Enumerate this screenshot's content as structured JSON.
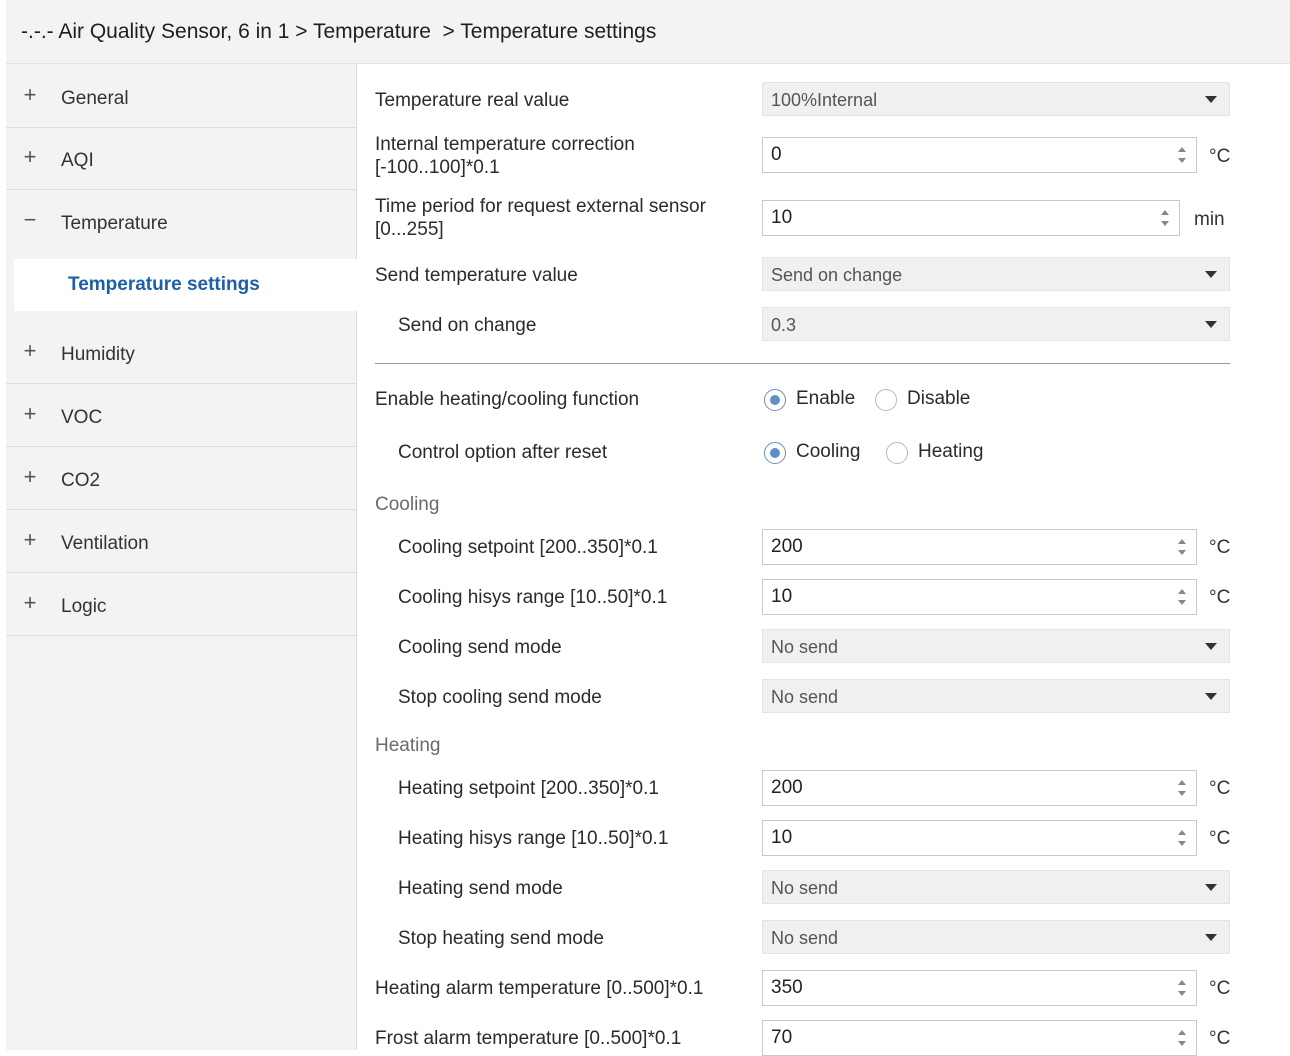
{
  "breadcrumb": "-.-.- Air Quality Sensor, 6 in 1 > Temperature  > Temperature settings",
  "sidebar": {
    "items": [
      {
        "sign": "+",
        "label": "General"
      },
      {
        "sign": "+",
        "label": "AQI"
      },
      {
        "sign": "−",
        "label": "Temperature"
      },
      {
        "sign": "+",
        "label": "Humidity"
      },
      {
        "sign": "+",
        "label": "VOC"
      },
      {
        "sign": "+",
        "label": "CO2"
      },
      {
        "sign": "+",
        "label": "Ventilation"
      },
      {
        "sign": "+",
        "label": "Logic"
      }
    ],
    "active_sub": "Temperature settings"
  },
  "form": {
    "temp_real_value": {
      "label": "Temperature real value",
      "value": "100%Internal"
    },
    "internal_correction": {
      "label": "Internal temperature correction\n[-100..100]*0.1",
      "value": "0",
      "unit": "°C"
    },
    "time_period": {
      "label": "Time period for request external sensor\n[0...255]",
      "value": "10",
      "unit": "min"
    },
    "send_temp_value": {
      "label": "Send temperature value",
      "value": "Send on change"
    },
    "send_on_change": {
      "label": "Send on change",
      "value": "0.3"
    },
    "enable_hc": {
      "label": "Enable heating/cooling function",
      "opt1": "Enable",
      "opt2": "Disable",
      "selected": "Enable"
    },
    "control_option": {
      "label": "Control option after reset",
      "opt1": "Cooling",
      "opt2": "Heating",
      "selected": "Cooling"
    },
    "cooling_section": "Cooling",
    "cooling_setpoint": {
      "label": "Cooling setpoint [200..350]*0.1",
      "value": "200",
      "unit": "°C"
    },
    "cooling_hisys": {
      "label": "Cooling hisys range [10..50]*0.1",
      "value": "10",
      "unit": "°C"
    },
    "cooling_send_mode": {
      "label": "Cooling send mode",
      "value": "No send"
    },
    "stop_cooling_send_mode": {
      "label": "Stop cooling send mode",
      "value": "No send"
    },
    "heating_section": "Heating",
    "heating_setpoint": {
      "label": "Heating setpoint [200..350]*0.1",
      "value": "200",
      "unit": "°C"
    },
    "heating_hisys": {
      "label": "Heating hisys range [10..50]*0.1",
      "value": "10",
      "unit": "°C"
    },
    "heating_send_mode": {
      "label": "Heating send mode",
      "value": "No send"
    },
    "stop_heating_send_mode": {
      "label": "Stop heating send mode",
      "value": "No send"
    },
    "heating_alarm": {
      "label": "Heating alarm temperature [0..500]*0.1",
      "value": "350",
      "unit": "°C"
    },
    "frost_alarm": {
      "label": "Frost alarm temperature [0..500]*0.1",
      "value": "70",
      "unit": "°C"
    }
  }
}
